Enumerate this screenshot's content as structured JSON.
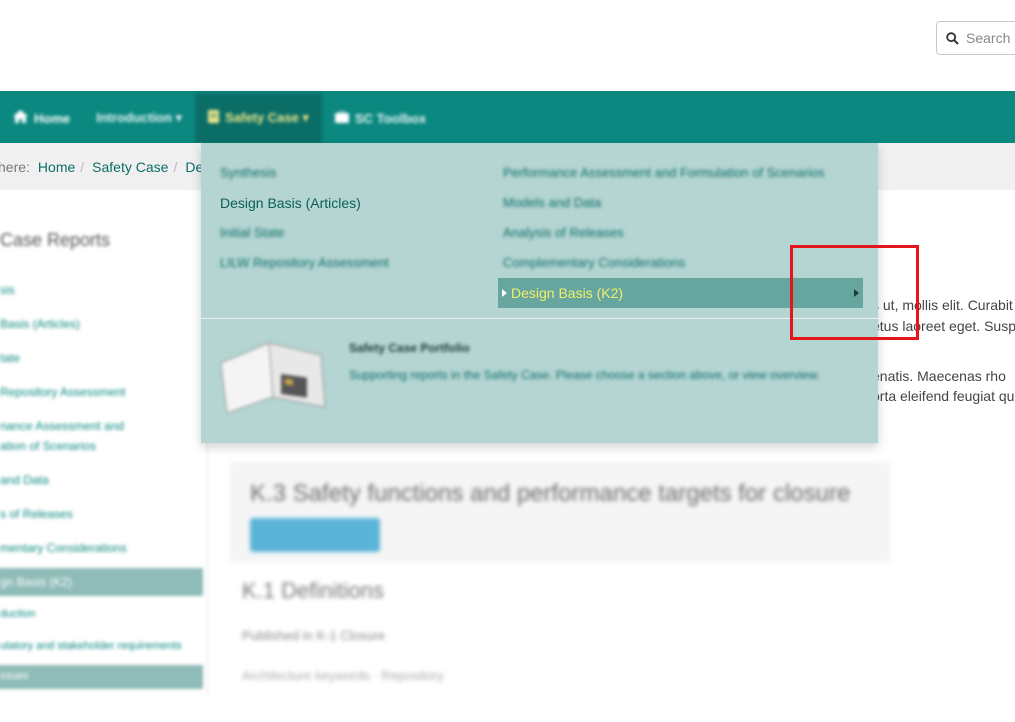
{
  "header": {
    "search_placeholder": "Search"
  },
  "nav": {
    "items": [
      {
        "label": "Home",
        "icon": "home-icon"
      },
      {
        "label": "Introduction ▾",
        "icon": ""
      },
      {
        "label": "Safety Case ▾",
        "icon": "document-icon",
        "active": true
      },
      {
        "label": "SC Toolbox",
        "icon": "briefcase-icon"
      }
    ]
  },
  "breadcrumb": {
    "label": "here:",
    "items": [
      "Home",
      "Safety Case",
      "De"
    ]
  },
  "sidebar": {
    "title": "Case Reports",
    "items": [
      "sis",
      "Basis (Articles)",
      "tate",
      "Repository Assessment",
      "nance Assessment and",
      "ation of Scenarios",
      "and Data",
      "s of Releases",
      "mentary Considerations",
      "gn Basis (K2)",
      "duction",
      "ulatory and stakeholder requirements",
      "ssues"
    ]
  },
  "dropdown": {
    "left_items": [
      "Synthesis",
      "Design Basis (Articles)",
      "Initial State",
      "LILW Repository Assessment"
    ],
    "right_items": [
      "Performance Assessment and Formulation of Scenarios",
      "Models and Data",
      "Analysis of Releases",
      "Complementary Considerations"
    ],
    "active_item": "Design Basis (K2)",
    "portfolio": {
      "title": "Safety Case Portfolio",
      "description": "Supporting reports in the Safety Case. Please choose a section above, or view overview."
    }
  },
  "content": {
    "partial_lines": [
      "s ut, mollis elit. Curabit",
      "etus laoreet eget. Susp",
      "enatis. Maecenas rho",
      "orta eleifend feugiat qu"
    ],
    "heading": "K.3 Safety functions and performance targets for closure",
    "subheading": "K.1 Definitions",
    "meta": "Published in  K-1 Closure",
    "meta2": "Architecture keywords · Repository"
  },
  "colors": {
    "nav_bg": "#0b8880",
    "dropdown_bg": "#b4d5d2",
    "active_item_bg": "#67a59f",
    "active_text": "#f0f06a",
    "annotation": "#e3171b"
  }
}
